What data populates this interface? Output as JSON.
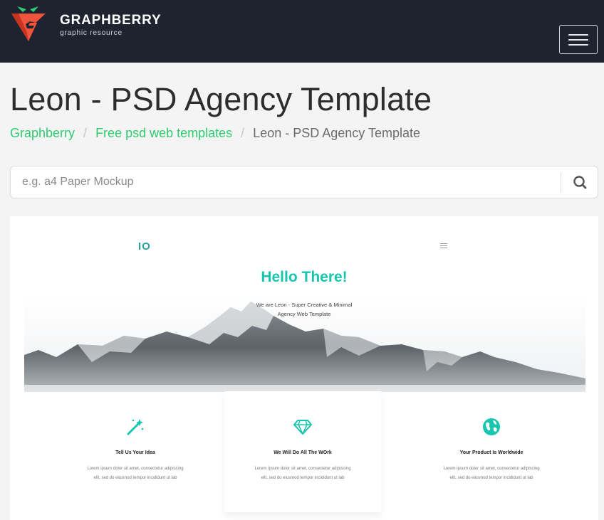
{
  "header": {
    "brand_name": "GRAPHBERRY",
    "brand_tagline": "graphic resource",
    "logo_icon": "graphberry-logo-icon",
    "menu_icon": "hamburger-menu-icon",
    "background_color": "#1f2330",
    "accent_color": "#f0543c"
  },
  "page": {
    "title": "Leon - PSD Agency Template"
  },
  "breadcrumb": {
    "items": [
      {
        "label": "Graphberry",
        "link": true
      },
      {
        "label": "Free psd web templates",
        "link": true
      },
      {
        "label": "Leon - PSD Agency Template",
        "link": false
      }
    ],
    "separator": "/",
    "link_color": "#2ecc71"
  },
  "search": {
    "placeholder": "e.g. a4 Paper Mockup",
    "value": "",
    "button_icon": "search-icon"
  },
  "preview": {
    "logo_text": "IO",
    "hero_title": "Hello There!",
    "hero_subtitle_line1": "We are Leon - Super Creative & Minimal",
    "hero_subtitle_line2": "Agency Web Template",
    "accent_color": "#18c5ae",
    "features": [
      {
        "icon": "magic-wand-icon",
        "title": "Tell Us Your Idea",
        "text": "Lorem ipsum dolor sit amet, consectetur adipiscing elit, sed do eiusmod tempor incididunt ut lab"
      },
      {
        "icon": "diamond-icon",
        "title": "We Will Do All The WOrk",
        "text": "Lorem ipsum dolor sit amet, consectetur adipiscing elit, sed do eiusmod tempor incididunt ut lab"
      },
      {
        "icon": "globe-icon",
        "title": "Your Product Is Worldwide",
        "text": "Lorem ipsum dolor sit amet, consectetur adipiscing elit, sed do eiusmod tempor incididunt ut lab"
      }
    ]
  }
}
